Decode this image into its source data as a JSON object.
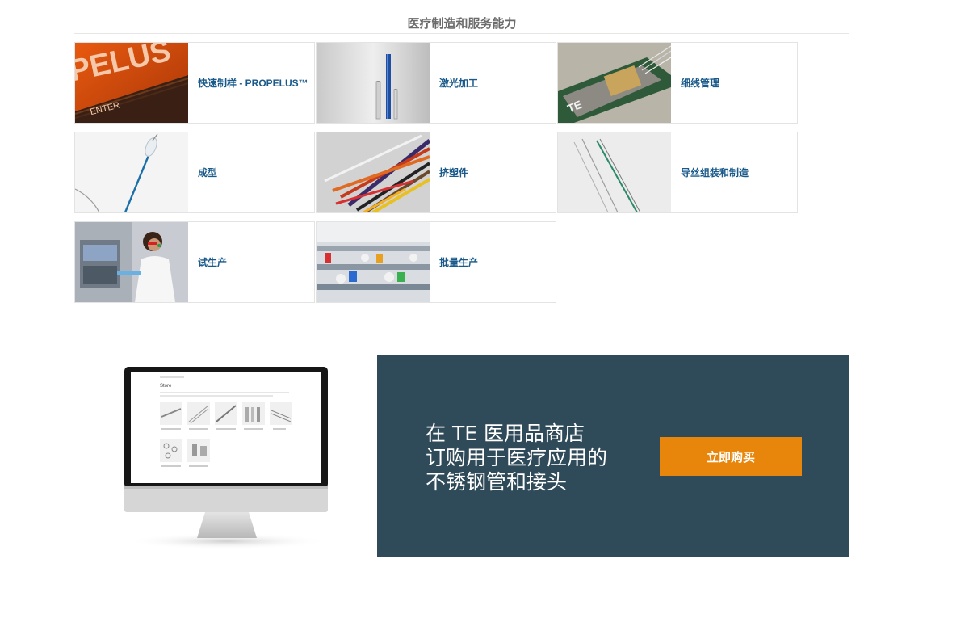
{
  "section": {
    "title": "医疗制造和服务能力"
  },
  "capabilities": [
    {
      "label": "快速制样 - PROPELUS™",
      "image_text": "PELUS",
      "image_subtext": "ENTER"
    },
    {
      "label": "激光加工"
    },
    {
      "label": "细线管理",
      "image_text": "TE"
    },
    {
      "label": "成型"
    },
    {
      "label": "挤塑件"
    },
    {
      "label": "导丝组装和制造"
    },
    {
      "label": "试生产"
    },
    {
      "label": "批量生产"
    }
  ],
  "promo": {
    "line1": "在 TE 医用品商店",
    "line2": "订购用于医疗应用的",
    "line3": "不锈钢管和接头",
    "button_label": "立即购买",
    "background_color": "#2f4a58",
    "button_color": "#e8860b",
    "monitor_screen": {
      "heading": "Store",
      "products": [
        "Hypodermic Needle Tubing",
        "Hypodermic Tubing",
        "Thin-Wall Tubing",
        "Precision Tubing",
        "Wire",
        "Tubular Components",
        "Component Fittings"
      ]
    }
  },
  "colors": {
    "link": "#1a5a8a",
    "title": "#6b6b6b"
  }
}
